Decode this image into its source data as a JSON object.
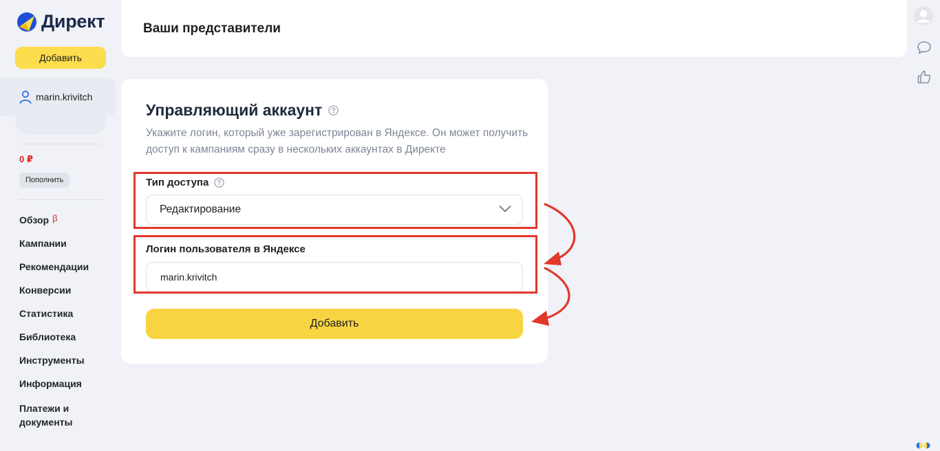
{
  "brand": {
    "name": "Директ"
  },
  "sidebar": {
    "add_button": "Добавить",
    "user": {
      "login": "marin.krivitch",
      "icon": "user-icon"
    },
    "balance": "0 ₽",
    "topup_button": "Пополнить",
    "nav": [
      {
        "label": "Обзор",
        "badge": "β"
      },
      {
        "label": "Кампании"
      },
      {
        "label": "Рекомендации"
      },
      {
        "label": "Конверсии"
      },
      {
        "label": "Статистика"
      },
      {
        "label": "Библиотека"
      },
      {
        "label": "Инструменты"
      },
      {
        "label": "Информация"
      },
      {
        "label": "Платежи и документы"
      }
    ]
  },
  "header": {
    "title": "Ваши представители"
  },
  "right_rail": {
    "icons": [
      "avatar-icon",
      "chat-bubble-icon",
      "thumbs-up-icon"
    ]
  },
  "form": {
    "title": "Управляющий аккаунт",
    "description": "Укажите логин, который уже зарегистрирован в Яндексе. Он может получить доступ к кампаниям сразу в нескольких аккаунтах в Директе",
    "access_type": {
      "label": "Тип доступа",
      "value": "Редактирование"
    },
    "login": {
      "label": "Логин пользователя в Яндексе",
      "value": "marin.krivitch"
    },
    "submit_button": "Добавить"
  },
  "colors": {
    "accent_yellow": "#fcdd4d",
    "balance_red": "#e5231b",
    "annotation_red": "#e2372b",
    "page_bg": "#f0f2f7"
  }
}
